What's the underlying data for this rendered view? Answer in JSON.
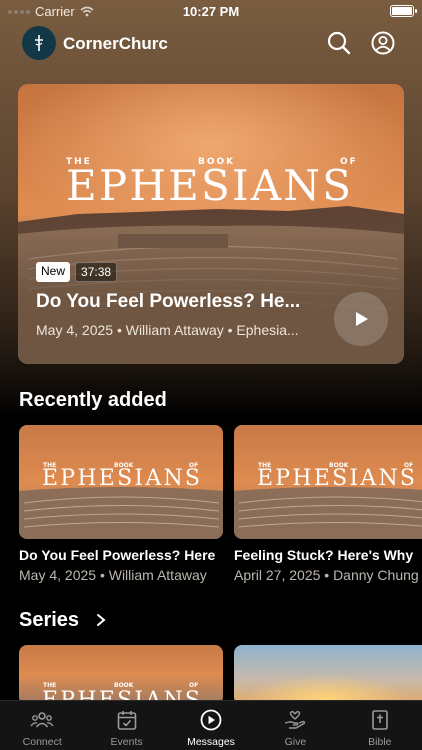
{
  "status_bar": {
    "carrier": "Carrier",
    "time": "10:27 PM"
  },
  "header": {
    "brand": "CornerChurc"
  },
  "artwork": {
    "word_the": "THE",
    "word_book": "BOOK",
    "word_of": "OF",
    "word_main": "EPHESIANS"
  },
  "hero": {
    "badge_new": "New",
    "duration": "37:38",
    "title": "Do You Feel Powerless? He...",
    "meta": "May 4, 2025 • William Attaway • Ephesia..."
  },
  "recently_added": {
    "heading": "Recently added",
    "items": [
      {
        "title": "Do You Feel Powerless? Here",
        "meta": "May 4, 2025 • William Attaway"
      },
      {
        "title": "Feeling Stuck? Here's Why",
        "meta": "April 27, 2025 • Danny Chung"
      }
    ]
  },
  "series": {
    "heading": "Series"
  },
  "tabs": [
    {
      "label": "Connect",
      "icon": "people-icon"
    },
    {
      "label": "Events",
      "icon": "calendar-icon"
    },
    {
      "label": "Messages",
      "icon": "play-circle-icon",
      "active": true
    },
    {
      "label": "Give",
      "icon": "give-hand-icon"
    },
    {
      "label": "Bible",
      "icon": "bible-icon"
    }
  ],
  "colors": {
    "accent_bg": "#7a5d40",
    "sky_orange": "#d97a3c",
    "logo_bg": "#123847"
  }
}
